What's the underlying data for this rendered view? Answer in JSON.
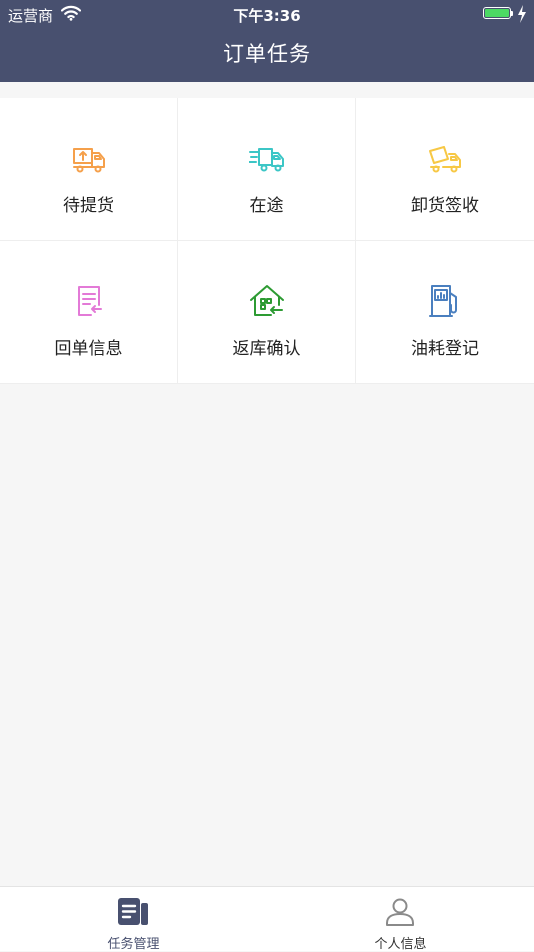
{
  "status_bar": {
    "carrier": "运营商",
    "time": "下午3:36",
    "battery_color": "#4cd964"
  },
  "header": {
    "title": "订单任务",
    "background": "#48506f"
  },
  "grid": {
    "items": [
      {
        "label": "待提货",
        "icon": "truck-loading-icon",
        "color": "#f5a04b"
      },
      {
        "label": "在途",
        "icon": "truck-moving-icon",
        "color": "#3cc6c6"
      },
      {
        "label": "卸货签收",
        "icon": "truck-dump-icon",
        "color": "#f7c845"
      },
      {
        "label": "回单信息",
        "icon": "receipt-icon",
        "color": "#e37ad7"
      },
      {
        "label": "返库确认",
        "icon": "house-return-icon",
        "color": "#2d9b33"
      },
      {
        "label": "油耗登记",
        "icon": "fuel-pump-icon",
        "color": "#4a7fbf"
      }
    ]
  },
  "tabbar": {
    "tabs": [
      {
        "label": "任务管理",
        "icon": "task-list-icon",
        "active": true
      },
      {
        "label": "个人信息",
        "icon": "person-icon",
        "active": false
      }
    ],
    "active_color": "#48506f"
  }
}
